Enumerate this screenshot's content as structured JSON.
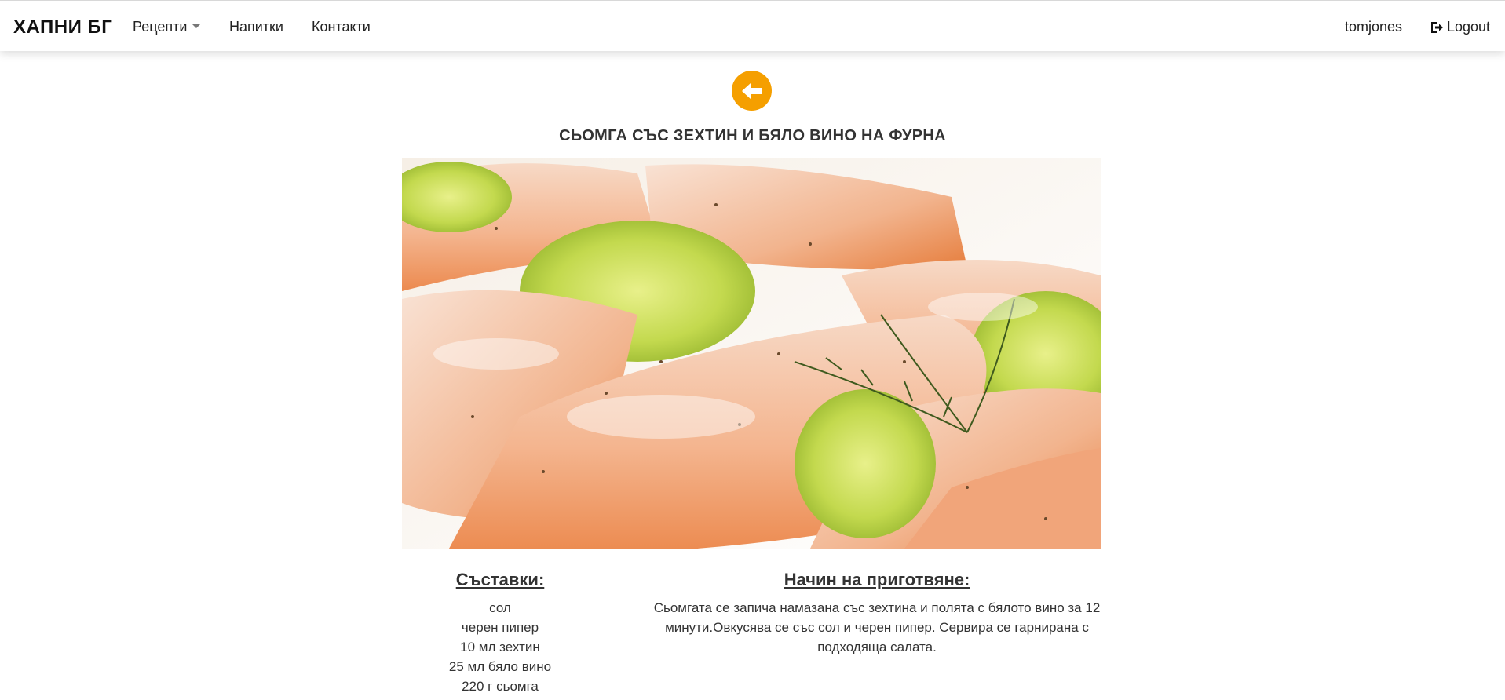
{
  "navbar": {
    "brand": "ХАПНИ БГ",
    "recipes_label": "Рецепти",
    "drinks_label": "Напитки",
    "contacts_label": "Контакти",
    "username": "tomjones",
    "logout_label": "Logout"
  },
  "recipe": {
    "title": "СЬОМГА СЪС ЗЕХТИН И БЯЛО ВИНО НА ФУРНА",
    "ingredients_heading": "Съставки:",
    "ingredients": [
      "сол",
      "черен пипер",
      "10 мл зехтин",
      "25 мл бяло вино",
      "220 г сьомга"
    ],
    "method_heading": "Начин на приготвяне:",
    "method": "Сьомгата се запича намазана със зехтина и полята с бялото вино за 12 минути.Овкусява се със сол и черен пипер. Сервира се гарнирана с подходяща салата."
  },
  "icons": {
    "back": "arrow-left-circle-icon",
    "logout": "logout-icon",
    "recipes_dropdown": "caret-down-icon"
  },
  "colors": {
    "accent": "#f59f00",
    "text": "#333333",
    "brand": "#111111"
  }
}
